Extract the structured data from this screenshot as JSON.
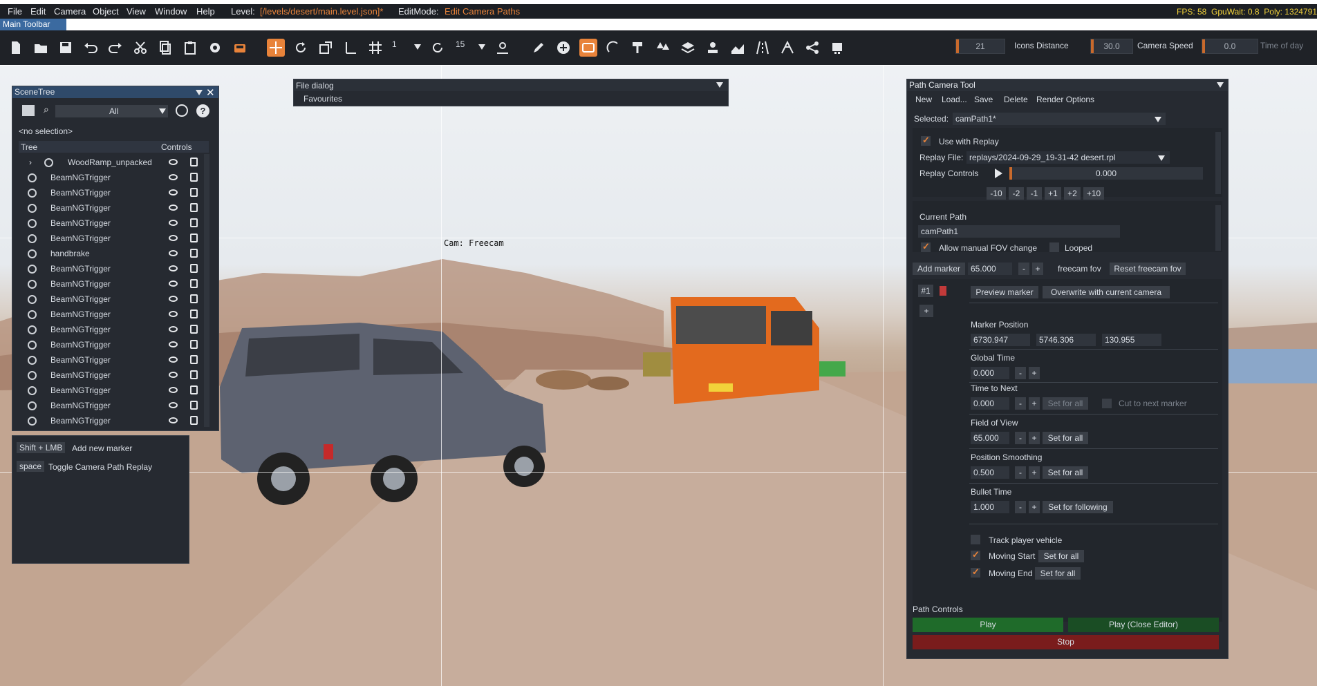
{
  "menu": {
    "items": [
      "File",
      "Edit",
      "Camera",
      "Object",
      "View",
      "Window",
      "Help"
    ],
    "level_label": "Level:",
    "level_value": "[/levels/desert/main.level.json]*",
    "editmode_label": "EditMode:",
    "editmode_value": "Edit Camera Paths",
    "stats": "FPS: 58  GpuWait: 0.8  Poly: 1324791"
  },
  "toolbar": {
    "title": "Main Toolbar",
    "snap_value_1": "1",
    "snap_value_2": "15",
    "icons_distance_value": "21",
    "icons_distance_label": "Icons Distance",
    "camera_speed_value": "30.0",
    "camera_speed_label": "Camera Speed",
    "time_of_day_value": "0.0",
    "time_of_day_label": "Time of day"
  },
  "scene_tree": {
    "title": "SceneTree",
    "filter_value": "All",
    "no_selection": "<no selection>",
    "col_tree": "Tree",
    "col_controls": "Controls",
    "rows": [
      "WoodRamp_unpacked",
      "BeamNGTrigger",
      "BeamNGTrigger",
      "BeamNGTrigger",
      "BeamNGTrigger",
      "BeamNGTrigger",
      "handbrake",
      "BeamNGTrigger",
      "BeamNGTrigger",
      "BeamNGTrigger",
      "BeamNGTrigger",
      "BeamNGTrigger",
      "BeamNGTrigger",
      "BeamNGTrigger",
      "BeamNGTrigger",
      "BeamNGTrigger",
      "BeamNGTrigger",
      "BeamNGTrigger"
    ]
  },
  "shortcuts": {
    "items": [
      {
        "key": "Shift + LMB",
        "label": "Add new marker"
      },
      {
        "key": "space",
        "label": "Toggle Camera Path Replay"
      }
    ]
  },
  "file_dialog": {
    "title": "File dialog",
    "favourites": "Favourites"
  },
  "viewport": {
    "cam_label": "Cam: Freecam"
  },
  "path_tool": {
    "title": "Path Camera Tool",
    "menu": [
      "New",
      "Load...",
      "Save",
      "Delete",
      "Render Options"
    ],
    "selected_label": "Selected:",
    "selected_value": "camPath1*",
    "use_with_replay": "Use with Replay",
    "replay_file_label": "Replay File:",
    "replay_file_value": "replays/2024-09-29_19-31-42 desert.rpl",
    "replay_controls_label": "Replay Controls",
    "replay_position": "0.000",
    "step_buttons": [
      "-10",
      "-2",
      "-1",
      "+1",
      "+2",
      "+10"
    ],
    "current_path_label": "Current Path",
    "current_path_value": "camPath1",
    "allow_fov": "Allow manual FOV change",
    "looped": "Looped",
    "add_marker": "Add marker",
    "fov_value": "65.000",
    "minus": "-",
    "plus": "+",
    "freecam_fov": "freecam fov",
    "reset_freecam_fov": "Reset freecam fov",
    "marker_tab": "#1",
    "add_tab": "+",
    "preview_marker": "Preview marker",
    "overwrite_camera": "Overwrite with current camera",
    "marker_position_label": "Marker Position",
    "pos_x": "6730.947",
    "pos_y": "5746.306",
    "pos_z": "130.955",
    "global_time_label": "Global Time",
    "global_time_value": "0.000",
    "time_to_next_label": "Time to Next",
    "time_to_next_value": "0.000",
    "set_for_all": "Set for all",
    "cut_to_next": "Cut to next marker",
    "fov_label": "Field of View",
    "fov_marker_value": "65.000",
    "pos_smoothing_label": "Position Smoothing",
    "pos_smoothing_value": "0.500",
    "bullet_time_label": "Bullet Time",
    "bullet_time_value": "1.000",
    "set_for_following": "Set for following",
    "track_player": "Track player vehicle",
    "moving_start": "Moving Start",
    "moving_end": "Moving End",
    "path_controls_label": "Path Controls",
    "play": "Play",
    "play_close": "Play (Close Editor)",
    "stop": "Stop"
  },
  "colors": {
    "accent": "#e8833a",
    "play_green": "#1f6b2a",
    "stop_red": "#7a1c1c",
    "panel_bg": "#262a31"
  }
}
